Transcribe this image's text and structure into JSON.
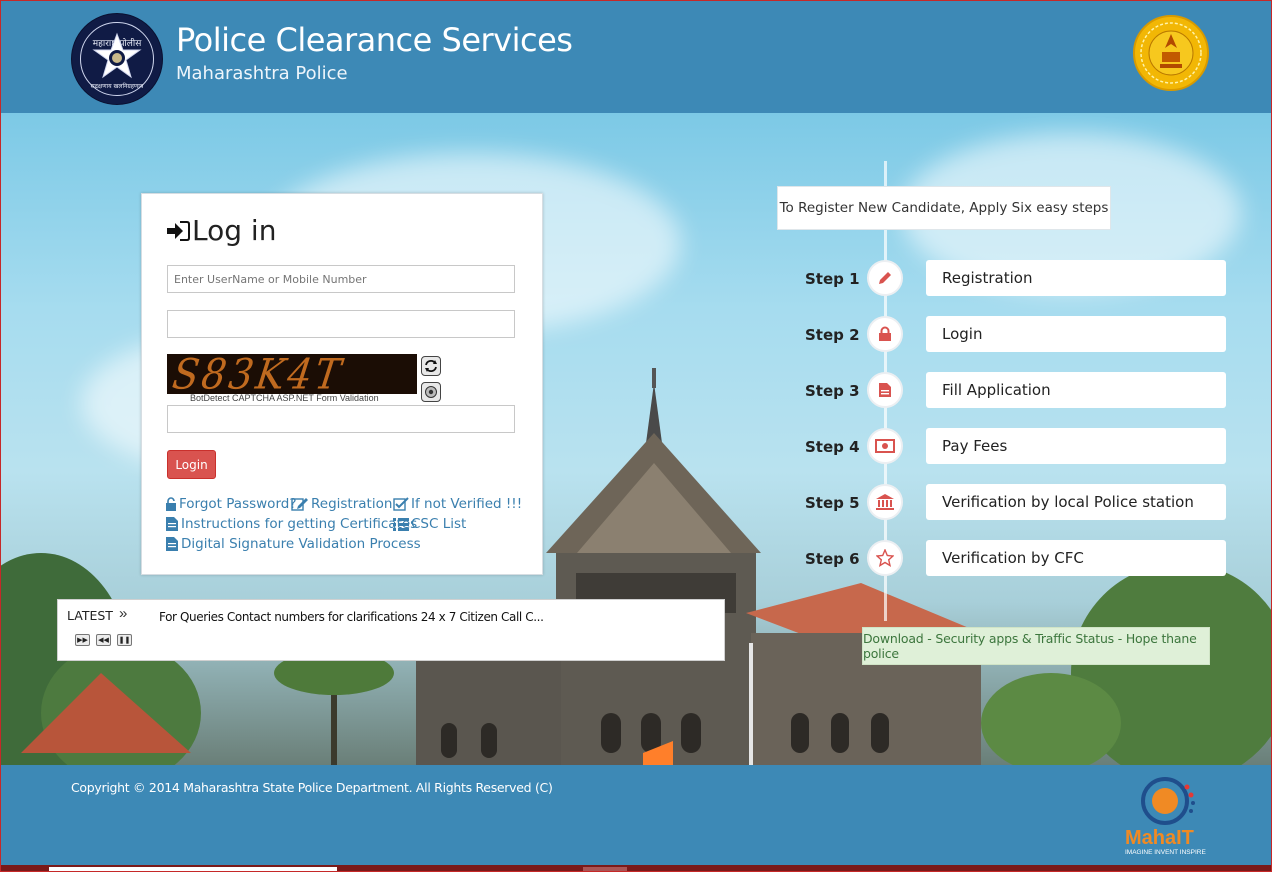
{
  "header": {
    "title": "Police Clearance Services",
    "subtitle": "Maharashtra Police",
    "emblem_top_text": "महाराष्ट्र पोलीस",
    "emblem_bottom_text": "सद्रक्षणाय खलनिग्रहणाय"
  },
  "login": {
    "title": "Log in",
    "username_placeholder": "Enter UserName or Mobile Number",
    "password_value": "",
    "captcha_text": "S83K4T",
    "captcha_note": "BotDetect CAPTCHA ASP.NET Form Validation",
    "captcha_input_value": "",
    "login_button": "Login",
    "links": {
      "forgot_password": "Forgot Password?",
      "registration": "Registration",
      "if_not_verified": "If not Verified !!!",
      "instructions": "Instructions for getting Certificates",
      "csc_list": "CSC List",
      "digital_signature": "Digital Signature Validation Process"
    }
  },
  "ticker": {
    "label": "LATEST",
    "text": "For Queries Contact numbers for clarifications 24 x 7 Citizen Call C..."
  },
  "steps": {
    "heading": "To Register New Candidate, Apply Six easy steps",
    "items": [
      {
        "label": "Step 1",
        "text": "Registration",
        "icon": "pencil-icon"
      },
      {
        "label": "Step 2",
        "text": "Login",
        "icon": "lock-icon"
      },
      {
        "label": "Step 3",
        "text": "Fill Application",
        "icon": "file-icon"
      },
      {
        "label": "Step 4",
        "text": "Pay Fees",
        "icon": "money-icon"
      },
      {
        "label": "Step 5",
        "text": "Verification by local Police station",
        "icon": "bank-icon"
      },
      {
        "label": "Step 6",
        "text": "Verification by CFC",
        "icon": "star-icon"
      }
    ]
  },
  "download_banner": "Download - Security apps & Traffic Status - Hope thane police",
  "footer": {
    "copyright": "Copyright © 2014 Maharashtra State Police Department. All Rights Reserved (C)",
    "logo_text": "MahaIT",
    "logo_tagline": "IMAGINE INVENT INSPIRE"
  },
  "colors": {
    "header_blue": "#3d89b6",
    "accent_red": "#d9534f",
    "link_blue": "#3a7fae",
    "success_green": "#3c763d"
  }
}
